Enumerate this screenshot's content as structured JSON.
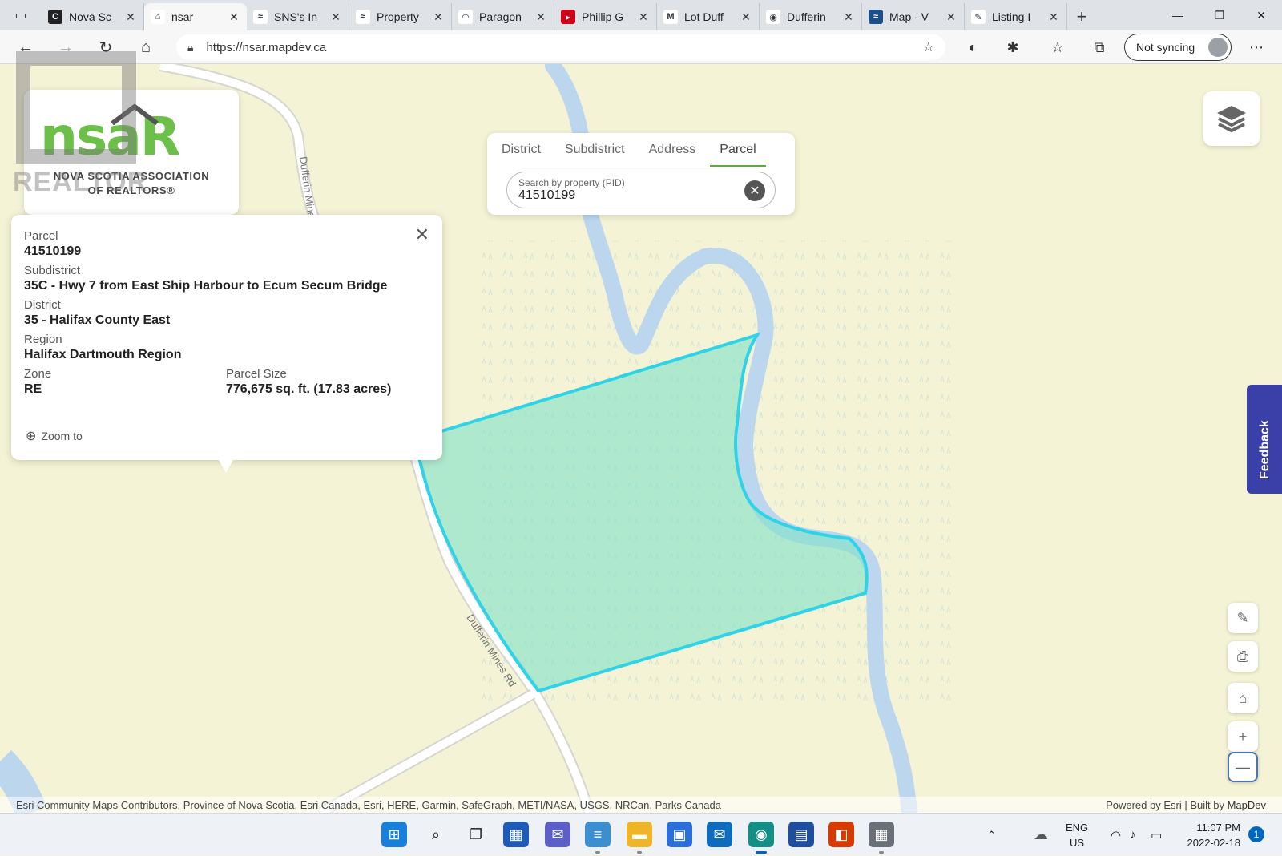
{
  "browser": {
    "tabs": [
      {
        "label": "Nova Sc",
        "fav_color": "#222222",
        "fav_glyph": "C"
      },
      {
        "label": "nsar",
        "fav_color": "#ffffff",
        "fav_glyph": "⌂",
        "active": true
      },
      {
        "label": "SNS's In",
        "fav_color": "#ffffff",
        "fav_glyph": "≈"
      },
      {
        "label": "Property",
        "fav_color": "#ffffff",
        "fav_glyph": "≈"
      },
      {
        "label": "Paragon",
        "fav_color": "#ffffff",
        "fav_glyph": "◠"
      },
      {
        "label": "Phillip G",
        "fav_color": "#d0021b",
        "fav_glyph": "▸"
      },
      {
        "label": "Lot Duff",
        "fav_color": "#ffffff",
        "fav_glyph": "M"
      },
      {
        "label": "Dufferin",
        "fav_color": "#ffffff",
        "fav_glyph": "◉"
      },
      {
        "label": "Map - V",
        "fav_color": "#1b4f8a",
        "fav_glyph": "≈"
      },
      {
        "label": "Listing I",
        "fav_color": "#ffffff",
        "fav_glyph": "✎"
      }
    ],
    "url": "https://nsar.mapdev.ca",
    "sync_label": "Not syncing"
  },
  "logo": {
    "word": "nsaR",
    "sub1": "NOVA SCOTIA ASSOCIATION",
    "sub2": "OF REALTORS®",
    "watermark": "REALTOR"
  },
  "search": {
    "tabs": [
      "District",
      "Subdistrict",
      "Address",
      "Parcel"
    ],
    "active_tab": "Parcel",
    "placeholder": "Search by property (PID)",
    "value": "41510199"
  },
  "popup": {
    "parcel_label": "Parcel",
    "parcel_value": "41510199",
    "subdistrict_label": "Subdistrict",
    "subdistrict_value": "35C - Hwy 7 from East Ship Harbour to Ecum Secum Bridge",
    "district_label": "District",
    "district_value": "35 - Halifax County East",
    "region_label": "Region",
    "region_value": "Halifax Dartmouth Region",
    "zone_label": "Zone",
    "zone_value": "RE",
    "size_label": "Parcel Size",
    "size_value": "776,675 sq. ft. (17.83 acres)",
    "zoom_label": "Zoom to"
  },
  "map": {
    "road_label_1": "Dufferin Mines Rd",
    "road_label_2": "Dufferin Mines Rd",
    "feedback_label": "Feedback",
    "attribution": "Esri Community Maps Contributors, Province of Nova Scotia, Esri Canada, Esri, HERE, Garmin, SafeGraph, METI/NASA, USGS, NRCan, Parks Canada",
    "powered_by": "Powered by Esri | Built by ",
    "powered_link": "MapDev",
    "parcel_color": "#2fd3e8",
    "water_color": "#bcd6ee"
  },
  "taskbar": {
    "lang_1": "ENG",
    "lang_2": "US",
    "time": "11:07 PM",
    "date": "2022-02-18",
    "notifications": "1"
  }
}
